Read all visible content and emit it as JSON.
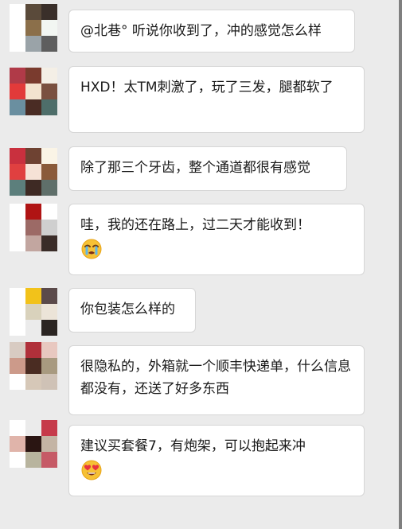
{
  "chat": {
    "messages": [
      {
        "text": "@北巷° 听说你收到了，冲的感觉怎么样",
        "avatar_colors": [
          "#ffffff",
          "#5a4a3a",
          "#3a2f2a",
          "#ffffff",
          "#8b6f4a",
          "#f2f6f2",
          "#ffffff",
          "#9aa3a8",
          "#5e5e5e"
        ]
      },
      {
        "text": "HXD！太TM刺激了，玩了三发，腿都软了",
        "avatar_colors": [
          "#b03a48",
          "#7a3b2e",
          "#f4efe6",
          "#e23a3a",
          "#f3e3cf",
          "#7a5040",
          "#6a8fa0",
          "#4a2c24",
          "#4e6e6a"
        ]
      },
      {
        "text": "除了那三个牙齿，整个通道都很有感觉",
        "avatar_colors": [
          "#c9303e",
          "#6e4232",
          "#faf4e6",
          "#e04040",
          "#f6e2d6",
          "#8a5a3a",
          "#5c7f7c",
          "#3e2a24",
          "#5f6f6a"
        ]
      },
      {
        "text": "哇，我的还在路上，过二天才能收到！",
        "emoji": "crying-emoji",
        "avatar_colors": [
          "#ffffff",
          "#b01414",
          "#ffffff",
          "#ffffff",
          "#9c6a66",
          "#cfcfcf",
          "#ffffff",
          "#c2a6a0",
          "#3a2c28"
        ]
      },
      {
        "text": "你包装怎么样的",
        "avatar_colors": [
          "#ffffff",
          "#f2c21a",
          "#5b4a4a",
          "#ffffff",
          "#d9d2bc",
          "#ece4d8",
          "#ffffff",
          "#ebebeb",
          "#2b2522"
        ]
      },
      {
        "text": "很隐私的，外箱就一个顺丰快递单，什么信息都没有，还送了好多东西",
        "avatar_colors": [
          "#d8cbc2",
          "#b0303a",
          "#e8c8c0",
          "#cc9a8a",
          "#4a2c22",
          "#a89a80",
          "#ffffff",
          "#d6c8b8",
          "#cfc2b6"
        ]
      },
      {
        "text": "建议买套餐7，有炮架，可以抱起来冲",
        "emoji": "heart-eyes-emoji",
        "avatar_colors": [
          "#ffffff",
          "#ebebeb",
          "#c63a4a",
          "#e0b4aa",
          "#2a1512",
          "#c4b4a4",
          "#ffffff",
          "#b8b49e",
          "#c65a66"
        ]
      }
    ]
  }
}
